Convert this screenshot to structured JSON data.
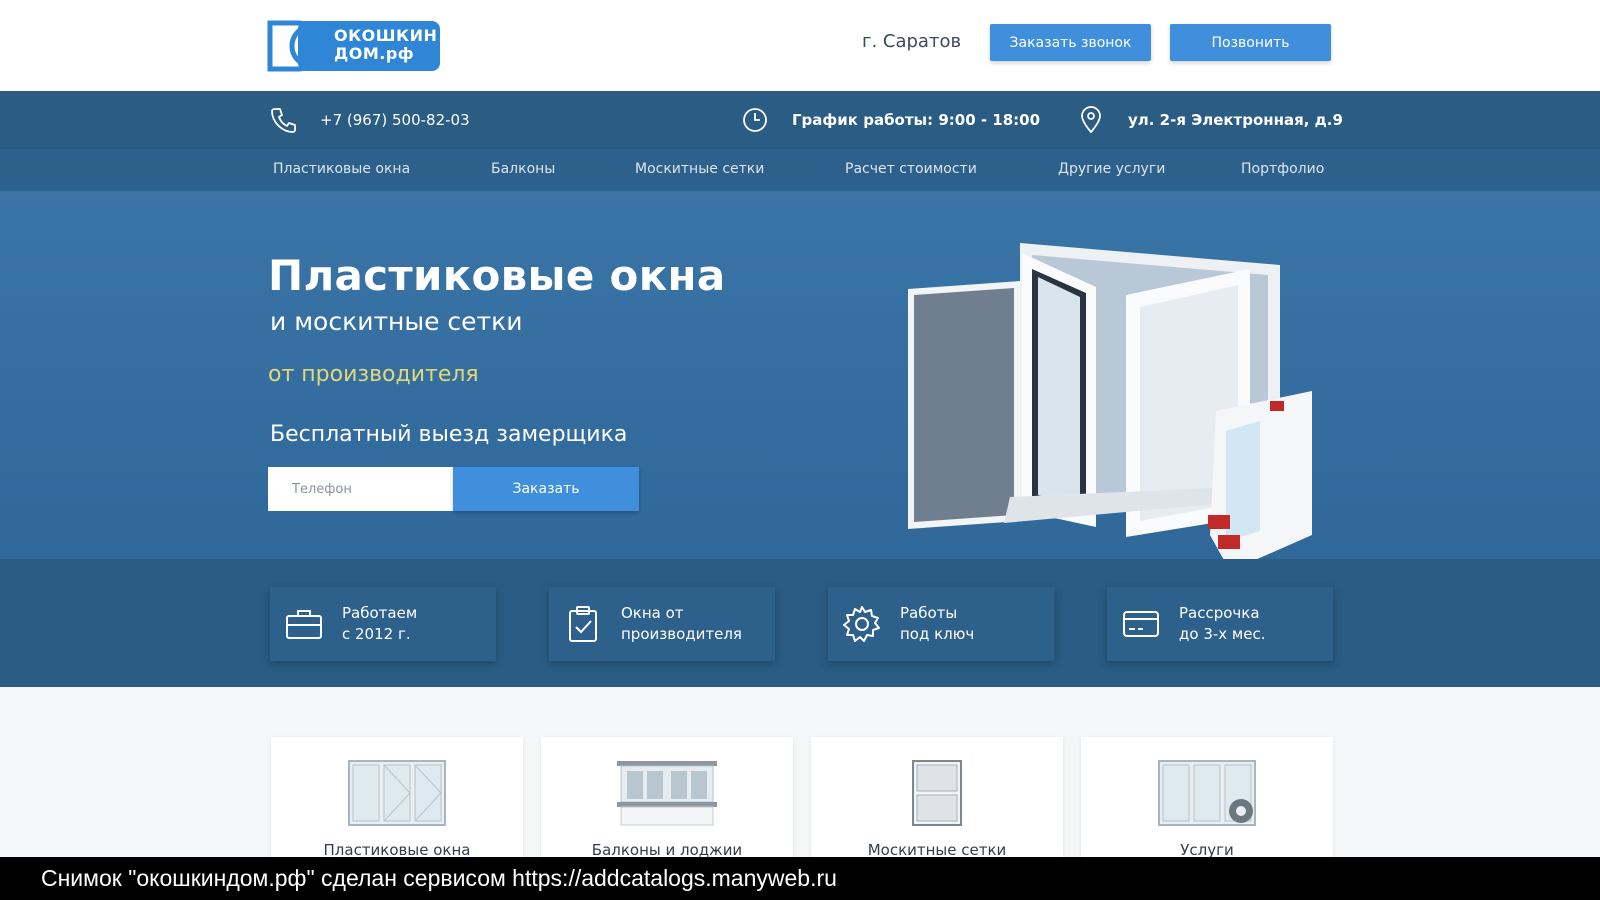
{
  "header": {
    "logo_line1": "ОКОШКИН",
    "logo_line2": "ДОМ.рф",
    "city": "г. Саратов",
    "call_button": "Заказать звонок",
    "phone_button": "Позвонить"
  },
  "info": {
    "phone": "+7 (967) 500-82-03",
    "hours": "График работы: 9:00 - 18:00",
    "address": "ул. 2-я Электронная, д.9"
  },
  "nav": {
    "items": [
      "Пластиковые окна",
      "Балконы",
      "Москитные сетки",
      "Расчет стоимости",
      "Другие услуги",
      "Портфолио"
    ]
  },
  "hero": {
    "title": "Пластиковые окна",
    "subtitle": "и москитные сетки",
    "accent": "от производителя",
    "free_measure": "Бесплатный выезд замерщика",
    "phone_placeholder": "Телефон",
    "order_button": "Заказать"
  },
  "features": [
    {
      "line1": "Работаем",
      "line2": "с 2012 г.",
      "icon": "briefcase-icon"
    },
    {
      "line1": "Окна от",
      "line2": "производителя",
      "icon": "clipboard-check-icon"
    },
    {
      "line1": "Работы",
      "line2": "под ключ",
      "icon": "gear-icon"
    },
    {
      "line1": "Рассрочка",
      "line2": "до 3-х мес.",
      "icon": "credit-card-icon"
    }
  ],
  "services": [
    {
      "label": "Пластиковые окна",
      "icon": "window-triple-icon"
    },
    {
      "label": "Балконы и лоджии",
      "icon": "balcony-icon"
    },
    {
      "label": "Москитные сетки",
      "icon": "mosquito-net-icon"
    },
    {
      "label": "Услуги",
      "icon": "window-service-icon"
    }
  ],
  "caption": "Снимок \"окошкиндом.рф\" сделан сервисом https://addcatalogs.manyweb.ru",
  "colors": {
    "primary_blue": "#3f8fdc",
    "dark_band": "#2a5c84",
    "hero_blue": "#3a75a8",
    "accent_yellow": "#e4d77a"
  }
}
